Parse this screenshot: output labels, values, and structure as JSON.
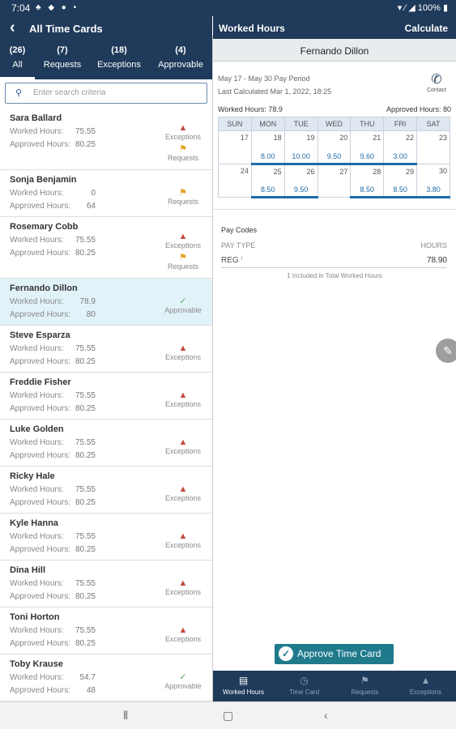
{
  "status_bar": {
    "time": "7:04",
    "battery": "100%"
  },
  "left_panel": {
    "title": "All Time Cards",
    "tabs": [
      {
        "count": "(26)",
        "label": "All"
      },
      {
        "count": "(7)",
        "label": "Requests"
      },
      {
        "count": "(18)",
        "label": "Exceptions"
      },
      {
        "count": "(4)",
        "label": "Approvable"
      }
    ],
    "search_placeholder": "Enter search criteria",
    "worked_label": "Worked Hours:",
    "approved_label": "Approved Hours:",
    "employees": [
      {
        "name": "Sara Ballard",
        "worked": "75.55",
        "approved": "80.25",
        "badges": [
          "Exceptions",
          "Requests"
        ]
      },
      {
        "name": "Sonja Benjamin",
        "worked": "0",
        "approved": "64",
        "badges": [
          "Requests"
        ]
      },
      {
        "name": "Rosemary Cobb",
        "worked": "75.55",
        "approved": "80.25",
        "badges": [
          "Exceptions",
          "Requests"
        ]
      },
      {
        "name": "Fernando Dillon",
        "worked": "78.9",
        "approved": "80",
        "badges": [
          "Approvable"
        ],
        "selected": true
      },
      {
        "name": "Steve Esparza",
        "worked": "75.55",
        "approved": "80.25",
        "badges": [
          "Exceptions"
        ]
      },
      {
        "name": "Freddie Fisher",
        "worked": "75.55",
        "approved": "80.25",
        "badges": [
          "Exceptions"
        ]
      },
      {
        "name": "Luke Golden",
        "worked": "75.55",
        "approved": "80.25",
        "badges": [
          "Exceptions"
        ]
      },
      {
        "name": "Ricky Hale",
        "worked": "75.55",
        "approved": "80.25",
        "badges": [
          "Exceptions"
        ]
      },
      {
        "name": "Kyle Hanna",
        "worked": "75.55",
        "approved": "80.25",
        "badges": [
          "Exceptions"
        ]
      },
      {
        "name": "Dina Hill",
        "worked": "75.55",
        "approved": "80.25",
        "badges": [
          "Exceptions"
        ]
      },
      {
        "name": "Toni Horton",
        "worked": "75.55",
        "approved": "80.25",
        "badges": [
          "Exceptions"
        ]
      },
      {
        "name": "Toby Krause",
        "worked": "54.7",
        "approved": "48",
        "badges": [
          "Approvable"
        ]
      }
    ]
  },
  "right_panel": {
    "title": "Worked Hours",
    "calculate": "Calculate",
    "employee": "Fernando Dillon",
    "period": "May 17 - May 30 Pay Period",
    "last_calculated": "Last Calculated Mar 1, 2022, 18:25",
    "contact": "Contact",
    "worked_summary": "Worked Hours: 78.9",
    "approved_summary": "Approved Hours: 80",
    "weekdays": [
      "SUN",
      "MON",
      "TUE",
      "WED",
      "THU",
      "FRI",
      "SAT"
    ],
    "weeks": [
      [
        {
          "day": "17",
          "hours": ""
        },
        {
          "day": "18",
          "hours": "8.00"
        },
        {
          "day": "19",
          "hours": "10.00"
        },
        {
          "day": "20",
          "hours": "9.50"
        },
        {
          "day": "21",
          "hours": "9.60"
        },
        {
          "day": "22",
          "hours": "3.00"
        },
        {
          "day": "23",
          "hours": ""
        }
      ],
      [
        {
          "day": "24",
          "hours": ""
        },
        {
          "day": "25",
          "hours": "8.50"
        },
        {
          "day": "26",
          "hours": "9.50"
        },
        {
          "day": "27",
          "hours": ""
        },
        {
          "day": "28",
          "hours": "8.50"
        },
        {
          "day": "29",
          "hours": "8.50"
        },
        {
          "day": "30",
          "hours": "3.80"
        }
      ]
    ],
    "pay_codes": {
      "title": "Pay Codes",
      "pay_type_header": "PAY TYPE",
      "hours_header": "HOURS",
      "rows": [
        {
          "type": "REG",
          "hours": "78.90"
        }
      ],
      "included_note": "1 Included in Total Worked Hours"
    },
    "approve_button": "Approve Time Card",
    "bottom_tabs": [
      "Worked Hours",
      "Time Card",
      "Requests",
      "Exceptions"
    ]
  },
  "colors": {
    "header": "#1f3a5a",
    "accent": "#1f7a8c",
    "selected_row": "#e1f3f9",
    "exception": "#c04a3e",
    "request": "#e0a51e",
    "approvable": "#5bb15e"
  }
}
